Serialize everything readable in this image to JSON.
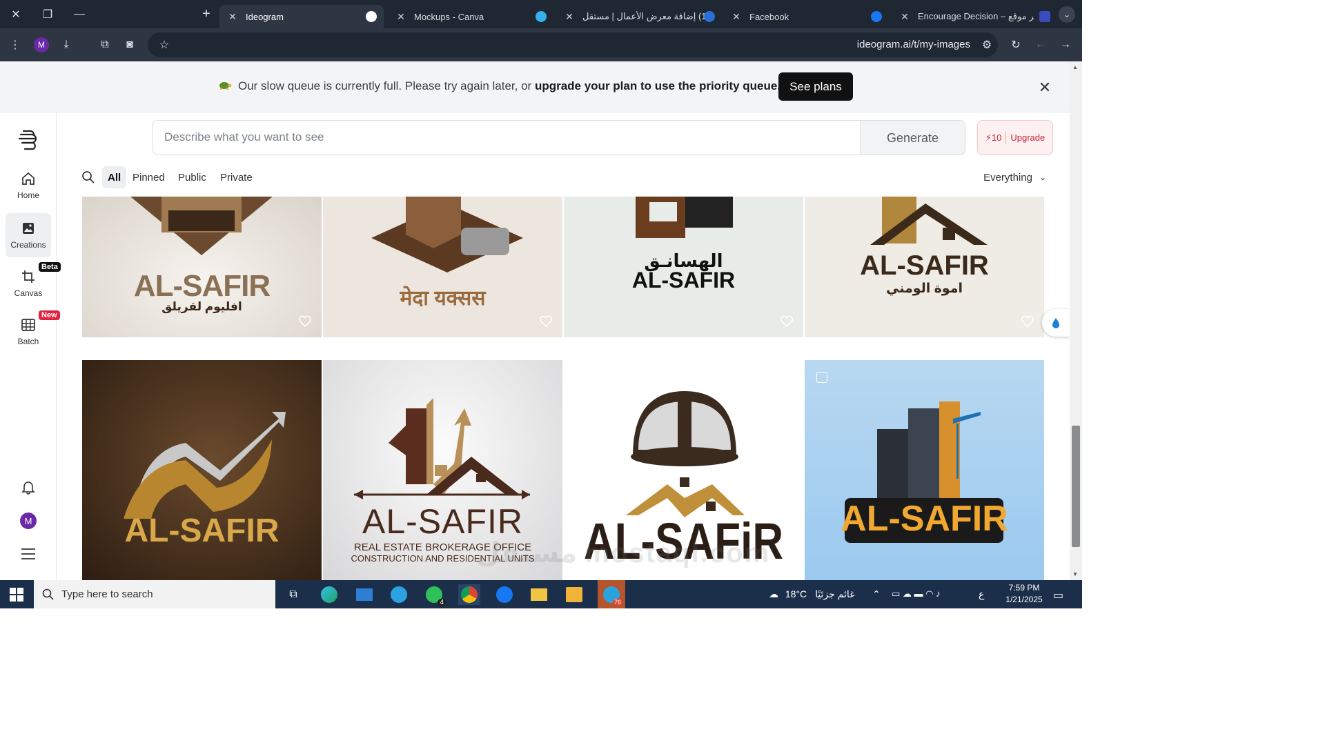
{
  "browser": {
    "tabs": [
      {
        "title": "Ideogram",
        "active": true
      },
      {
        "title": "Mockups - Canva"
      },
      {
        "title": "(1) إضافة معرض الأعمال | مستقل"
      },
      {
        "title": "Facebook"
      },
      {
        "title": "Encourage Decision – آخر موقع"
      }
    ],
    "url": "ideogram.ai/t/my-images",
    "profile_initial": "M"
  },
  "banner": {
    "text_plain": "Our slow queue is currently full. Please try again later, or ",
    "text_bold": "upgrade your plan to use the priority queue.",
    "cta": "See plans"
  },
  "sidebar": {
    "items": [
      {
        "label": "Home"
      },
      {
        "label": "Creations",
        "active": true
      },
      {
        "label": "Canvas",
        "badge": "Beta"
      },
      {
        "label": "Batch",
        "badge": "New"
      }
    ],
    "avatar_initial": "M"
  },
  "prompt": {
    "placeholder": "Describe what you want to see",
    "generate": "Generate"
  },
  "credits": {
    "count": "10",
    "upgrade": "Upgrade"
  },
  "filters": {
    "tabs": [
      "All",
      "Pinned",
      "Public",
      "Private"
    ],
    "active": "All",
    "scope": "Everything"
  },
  "gallery": {
    "row1": [
      {
        "title": "AL-SAFIR",
        "subtitle": "افليوم لقريلق"
      },
      {
        "title": "मेदा यक्सस"
      },
      {
        "title": "AL-SAFIR",
        "subtitle": "الهسانـق"
      },
      {
        "title": "AL-SAFIR",
        "subtitle": "اموة الومني"
      }
    ],
    "row2": [
      {
        "title": "AL-SAFIR"
      },
      {
        "title": "AL-SAFIR",
        "line1": "REAL ESTATE BROKERAGE OFFICE",
        "line2": "CONSTRUCTION AND RESIDENTIAL UNITS"
      },
      {
        "title": "AL-SAFiR"
      },
      {
        "title": "AL-SAFIR"
      }
    ]
  },
  "watermark": "مستقل mostaql.com",
  "taskbar": {
    "search_placeholder": "Type here to search",
    "weather": "18°C",
    "weather_text": "غائم جزئيًا",
    "lang": "ع",
    "time": "7:59 PM",
    "date": "1/21/2025",
    "whatsapp_badge": "4",
    "telegram_badge": "76"
  },
  "colors": {
    "tabstrip": "#1f2733",
    "toolbar": "#2e3643",
    "brand_red": "#c8233b",
    "taskbar": "#1b2f4a"
  }
}
